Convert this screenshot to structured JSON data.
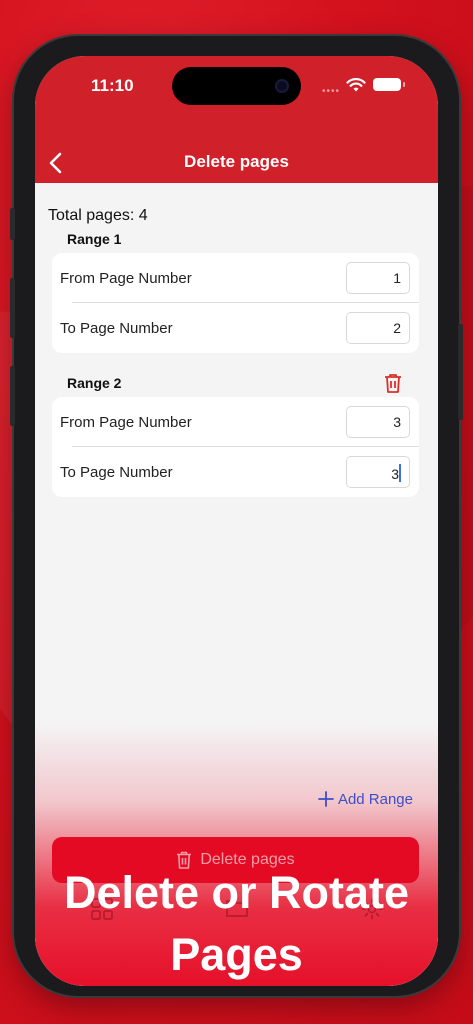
{
  "status_bar": {
    "time": "11:10"
  },
  "nav": {
    "title": "Delete pages"
  },
  "summary": {
    "total_pages": "Total pages: 4"
  },
  "ranges": [
    {
      "label": "Range 1",
      "from_label": "From Page Number",
      "from_value": "1",
      "to_label": "To Page Number",
      "to_value": "2"
    },
    {
      "label": "Range 2",
      "from_label": "From Page Number",
      "from_value": "3",
      "to_label": "To Page Number",
      "to_value": "3"
    }
  ],
  "actions": {
    "add_range": "Add Range",
    "delete_pages": "Delete pages"
  },
  "promo": {
    "headline_line1": "Delete or Rotate",
    "headline_line2": "Pages"
  },
  "icons": [
    "back-chevron-icon",
    "trash-icon",
    "plus-icon",
    "grid-icon",
    "folder-icon",
    "gear-icon",
    "wifi-icon",
    "battery-icon"
  ],
  "colors": {
    "brand_red": "#d0202a",
    "button_red": "#e40a24",
    "link_blue": "#3d4fc4"
  }
}
